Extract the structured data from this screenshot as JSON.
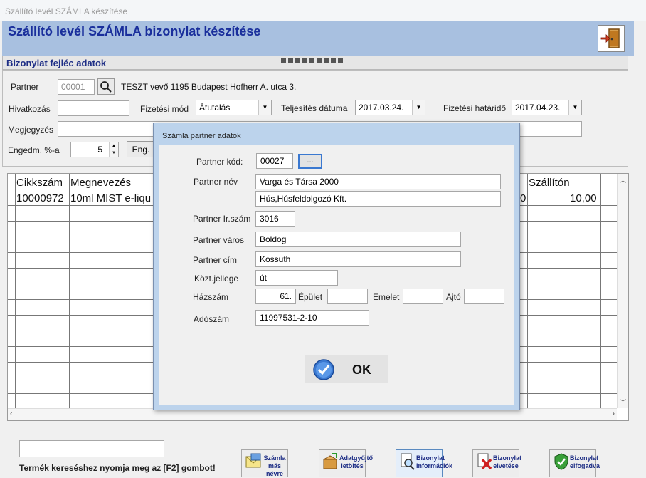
{
  "window": {
    "title": "Szállító levél SZÁMLA készítése"
  },
  "header": {
    "title": "Szállító levél SZÁMLA bizonylat készítése",
    "exit_icon": "exit-door-icon"
  },
  "section": {
    "title": "Bizonylat fejléc adatok"
  },
  "form": {
    "partner_label": "Partner",
    "partner_code": "00001",
    "partner_text": "TESZT vevő 1195 Budapest Hofherr A. utca 3.",
    "hivatkozas_label": "Hivatkozás",
    "hivatkozas_value": "",
    "fizetesi_mod_label": "Fizetési mód",
    "fizetesi_mod_value": "Átutalás",
    "teljesites_label": "Teljesítés dátuma",
    "teljesites_value": "2017.03.24.",
    "hatarido_label": "Fizetési határidő",
    "hatarido_value": "2017.04.23.",
    "megjegyzes_label": "Megjegyzés",
    "engedm_label": "Engedm. %-a",
    "engedm_value": "5",
    "eng_button": "Eng."
  },
  "grid": {
    "headers": {
      "cikkszam": "Cikkszám",
      "megnevezes": "Megnevezés",
      "szallitott": "Szállítón"
    },
    "rows": [
      {
        "cikkszam": "10000972",
        "megnevezes": "10ml MIST e-liqu",
        "partial": "0",
        "szallitott": "10,00"
      }
    ]
  },
  "modal": {
    "title": "Számla partner adatok",
    "partner_kod_label": "Partner kód:",
    "partner_kod": "00027",
    "lookup_button": "...",
    "partner_nev_label": "Partner név",
    "partner_nev_1": "Varga és Társa 2000",
    "partner_nev_2": "Hús,Húsfeldolgozó Kft.",
    "irszam_label": "Partner Ir.szám",
    "irszam": "3016",
    "varos_label": "Partner város",
    "varos": "Boldog",
    "cim_label": "Partner cím",
    "cim": "Kossuth",
    "kozt_label": "Közt.jellege",
    "kozt": "út",
    "hazszam_label": "Házszám",
    "hazszam": "61.",
    "epulet_label": "Épület",
    "epulet": "",
    "emelet_label": "Emelet",
    "emelet": "",
    "ajto_label": "Ajtó",
    "ajto": "",
    "adoszam_label": "Adószám",
    "adoszam": "11997531-2-10",
    "ok_label": "OK"
  },
  "footer": {
    "hint": "Termék kereséshez nyomja meg az [F2] gombot!",
    "buttons": [
      {
        "label": "Számla más névre"
      },
      {
        "label": "Adatgyűjtő letöltés"
      },
      {
        "label": "Bizonylat információk"
      },
      {
        "label": "Bizonylat elvetése"
      },
      {
        "label": "Bizonylat elfogadva"
      }
    ]
  }
}
